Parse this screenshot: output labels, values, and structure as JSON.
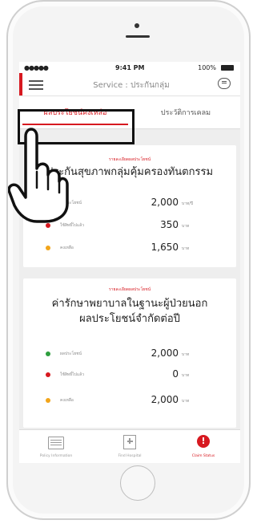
{
  "status_bar": {
    "signal": "●●●●● ",
    "time": "9:41 PM",
    "battery": "100%"
  },
  "nav": {
    "title": "Service : ประกันกลุ่ม"
  },
  "tabs": [
    {
      "label": "ผลประโยชน์คงเหลือ",
      "active": true
    },
    {
      "label": "ประวัติการเคลม",
      "active": false
    }
  ],
  "cards": [
    {
      "subtitle": "รายละเอียดผลประโยชน์",
      "title_lines": [
        "ประกันสุขภาพกลุ่มคุ้มครองทันตกรรม"
      ],
      "rows": [
        {
          "label": "ผลประโยชน์",
          "value": "2,000",
          "unit": "บาท/ปี",
          "color": "#2e9e3e"
        },
        {
          "label": "ใช้สิทธิ์ไปแล้ว",
          "value": "350",
          "unit": "บาท",
          "color": "#d71920"
        },
        {
          "label": "คงเหลือ",
          "value": "1,650",
          "unit": "บาท",
          "color": "#f2a51a"
        }
      ]
    },
    {
      "subtitle": "รายละเอียดผลประโยชน์",
      "title_lines": [
        "ค่ารักษาพยาบาลในฐานะผู้ป่วยนอก",
        "ผลประโยชน์จำกัดต่อปี"
      ],
      "rows": [
        {
          "label": "ผลประโยชน์",
          "value": "2,000",
          "unit": "บาท",
          "color": "#2e9e3e"
        },
        {
          "label": "ใช้สิทธิ์ไปแล้ว",
          "value": "0",
          "unit": "บาท",
          "color": "#d71920"
        },
        {
          "label": "คงเหลือ",
          "value": "2,000",
          "unit": "บาท",
          "color": "#f2a51a"
        }
      ]
    }
  ],
  "bottom_tabs": [
    {
      "label": "Policy Information",
      "icon": "policy-icon"
    },
    {
      "label": "Find Hospital",
      "icon": "hospital-icon"
    },
    {
      "label": "Claim Status",
      "icon": "claim-status-icon",
      "active": true
    }
  ],
  "colors": {
    "accent": "#d71920",
    "green": "#2e9e3e",
    "orange": "#f2a51a"
  }
}
